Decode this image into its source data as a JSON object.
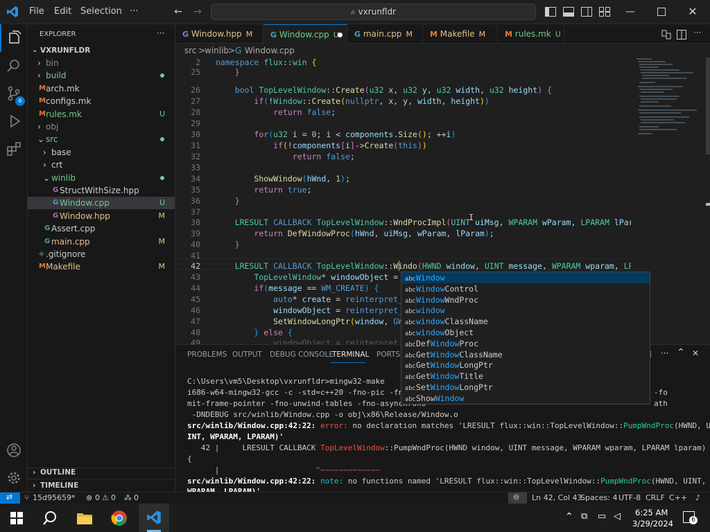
{
  "title_bar": {
    "menu": [
      "File",
      "Edit",
      "Selection",
      "···"
    ],
    "search": "vxrunfldr"
  },
  "sidebar": {
    "header": "EXPLORER",
    "more": "···",
    "root": "VXRUNFLDR",
    "items": [
      {
        "label": "bin",
        "arrow": ">",
        "color": "#8b8b8b",
        "badge": ""
      },
      {
        "label": "build",
        "arrow": ">",
        "color": "#73c991",
        "badge": ""
      },
      {
        "label": "arch.mk",
        "arrow": "",
        "color": "#cccccc",
        "badge": ""
      },
      {
        "label": "configs.mk",
        "arrow": "",
        "color": "#cccccc",
        "badge": ""
      },
      {
        "label": "rules.mk",
        "arrow": "",
        "color": "#73c991",
        "badge": "U"
      },
      {
        "label": "obj",
        "arrow": ">",
        "color": "#8b8b8b",
        "badge": ""
      },
      {
        "label": "src",
        "arrow": "v",
        "color": "#73c991",
        "badge": ""
      },
      {
        "label": "base",
        "arrow": ">",
        "color": "#cccccc",
        "badge": ""
      },
      {
        "label": "crt",
        "arrow": ">",
        "color": "#cccccc",
        "badge": ""
      },
      {
        "label": "winlib",
        "arrow": "v",
        "color": "#73c991",
        "badge": ""
      },
      {
        "label": "StructWithSize.hpp",
        "arrow": "",
        "color": "#cccccc",
        "badge": ""
      },
      {
        "label": "Window.cpp",
        "arrow": "",
        "color": "#73c991",
        "badge": "U"
      },
      {
        "label": "Window.hpp",
        "arrow": "",
        "color": "#e2c08d",
        "badge": "M"
      },
      {
        "label": "Assert.cpp",
        "arrow": "",
        "color": "#cccccc",
        "badge": ""
      },
      {
        "label": "main.cpp",
        "arrow": "",
        "color": "#e2c08d",
        "badge": "M"
      },
      {
        "label": ".gitignore",
        "arrow": "",
        "color": "#cccccc",
        "badge": ""
      },
      {
        "label": "Makefile",
        "arrow": "",
        "color": "#e2c08d",
        "badge": "M"
      }
    ],
    "outline": "OUTLINE",
    "timeline": "TIMELINE"
  },
  "tabs": [
    {
      "label": "Window.hpp",
      "badge": "M",
      "color": "#e2c08d"
    },
    {
      "label": "Window.cpp",
      "badge": "U",
      "color": "#73c991"
    },
    {
      "label": "main.cpp",
      "badge": "M",
      "color": "#e2c08d"
    },
    {
      "label": "Makefile",
      "badge": "M",
      "color": "#e2c08d"
    },
    {
      "label": "rules.mk",
      "badge": "U",
      "color": "#73c991"
    }
  ],
  "breadcrumb": {
    "parts": [
      "src",
      ">",
      "winlib",
      ">",
      "Window.cpp"
    ]
  },
  "editor": {
    "line_numbers": [
      "2",
      "25",
      "26",
      "27",
      "28",
      "29",
      "30",
      "31",
      "32",
      "33",
      "34",
      "35",
      "36",
      "37",
      "38",
      "39",
      "40",
      "41",
      "42",
      "43",
      "44",
      "45",
      "46",
      "47",
      "48",
      "49"
    ],
    "sticky": "namespace flux::win {"
  },
  "suggest": {
    "abc": "abc",
    "items": [
      {
        "pre": "",
        "match": "Window",
        "post": ""
      },
      {
        "pre": "",
        "match": "Window",
        "post": "Control"
      },
      {
        "pre": "",
        "match": "Window",
        "post": "WndProc"
      },
      {
        "pre": "",
        "match": "window",
        "post": ""
      },
      {
        "pre": "",
        "match": "window",
        "post": "ClassName"
      },
      {
        "pre": "",
        "match": "window",
        "post": "Object"
      },
      {
        "pre": "Def",
        "match": "Window",
        "post": "Proc"
      },
      {
        "pre": "Get",
        "match": "Window",
        "post": "ClassName"
      },
      {
        "pre": "Get",
        "match": "Window",
        "post": "LongPtr"
      },
      {
        "pre": "Get",
        "match": "Window",
        "post": "Title"
      },
      {
        "pre": "Set",
        "match": "Window",
        "post": "LongPtr"
      },
      {
        "pre": "Show",
        "match": "Window",
        "post": ""
      }
    ]
  },
  "panel": {
    "tabs": [
      "PROBLEMS",
      "OUTPUT",
      "DEBUG CONSOLE",
      "TERMINAL",
      "PORTS"
    ],
    "lines": [
      "C:\\Users\\vm5\\Desktop\\vxrunfldr>mingw32-make",
      "i686-w64-mingw32-gcc -c -std=c++20 -fno-pic -fno-pie",
      "mit-frame-pointer -fno-unwind-tables -fno-asynchrono",
      " -DNDEBUG src/winlib/Window.cpp -o obj\\x86\\Release/Window.o",
      "src/winlib/Window.cpp:42:22: error: no declaration matches 'LRESULT flux::win::TopLevelWindow::PumpWndProc(HWND, U",
      "INT, WPARAM, LPARAM)'",
      "   42 |     LRESULT CALLBACK TopLevelWindow::PumpWndProc(HWND window, UINT message, WPARAM wparam, LPARAM lparam)",
      "{",
      "      |                     ^~~~~~~~~~~~~~",
      "src/winlib/Window.cpp:42:22: note: no functions named 'LRESULT flux::win::TopLevelWindow::PumpWndProc(HWND, UINT,",
      "WPARAM, LPARAM)'"
    ],
    "tail1": "-fo",
    "tail2": "ath"
  },
  "status": {
    "branch": "15d95659*",
    "errors": "0",
    "warnings": "0",
    "ports": "0",
    "position": "Ln 42, Col 43",
    "spaces": "Spaces: 4",
    "encoding": "UTF-8",
    "eol": "CRLF",
    "language": "C++"
  },
  "taskbar": {
    "time": "6:25 AM",
    "date": "3/29/2024",
    "notifications": "6"
  },
  "colors": {
    "accent": "#0078d4",
    "git_added": "#73c991",
    "git_modified": "#e2c08d"
  }
}
